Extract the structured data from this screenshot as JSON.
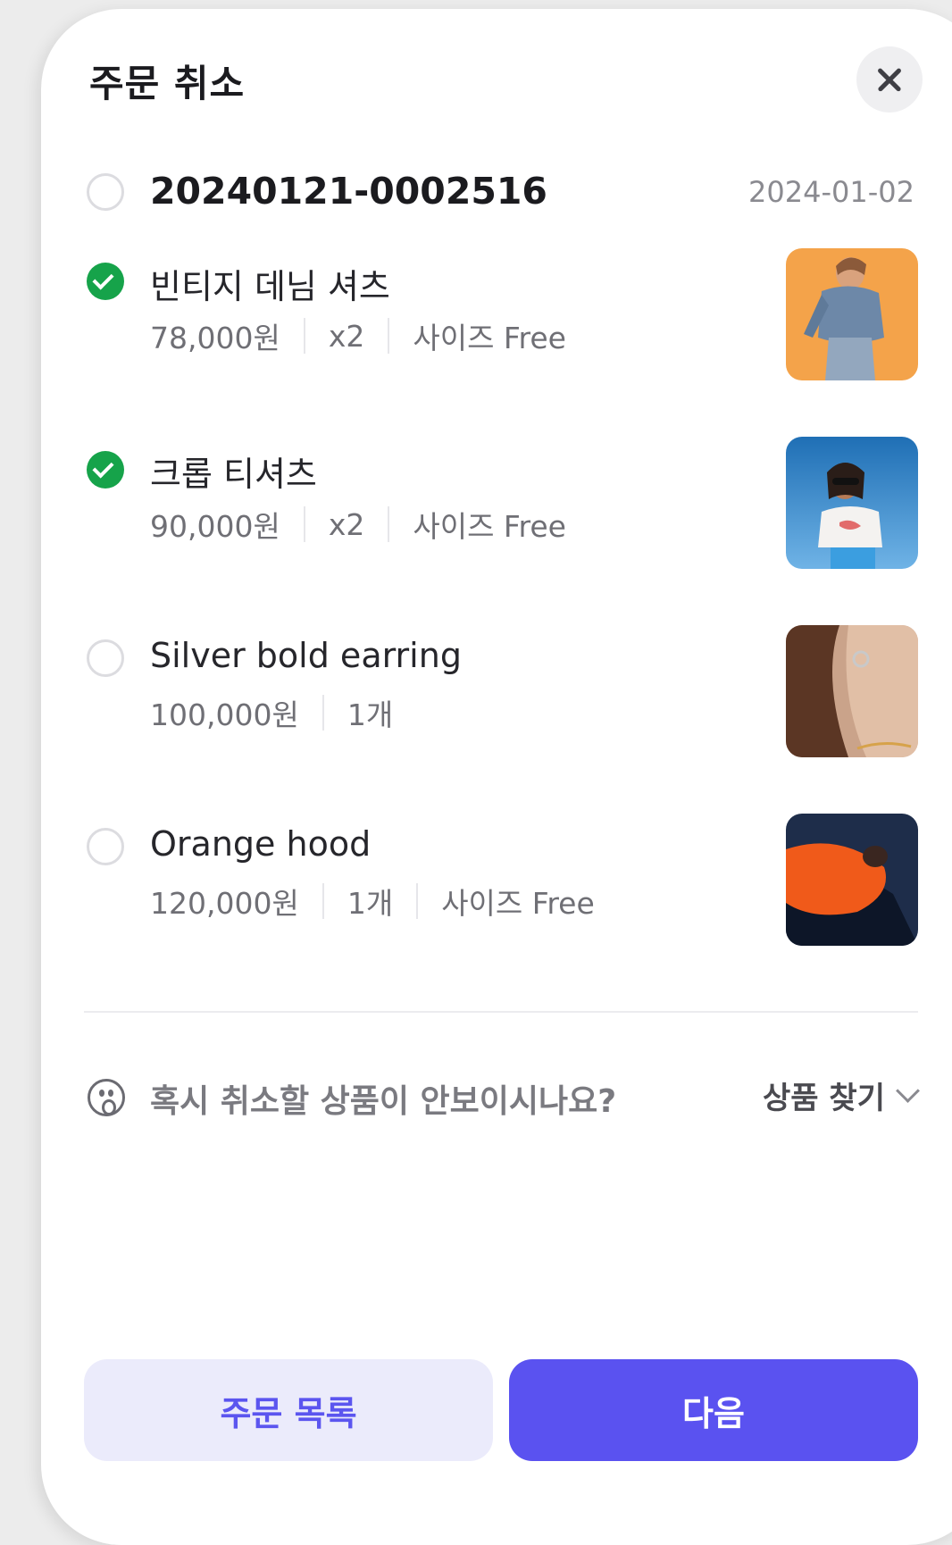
{
  "modal": {
    "title": "주문 취소"
  },
  "order": {
    "number": "20240121-0002516",
    "date": "2024-01-02",
    "checked": false
  },
  "items": [
    {
      "name": "빈티지 데님 셔츠",
      "price": "78,000원",
      "qty": "x2",
      "option": "사이즈 Free",
      "checked": true
    },
    {
      "name": "크롭 티셔츠",
      "price": "90,000원",
      "qty": "x2",
      "option": "사이즈 Free",
      "checked": true
    },
    {
      "name": "Silver bold earring",
      "price": "100,000원",
      "qty": "1개",
      "checked": false
    },
    {
      "name": "Orange hood",
      "price": "120,000원",
      "qty": "1개",
      "option": "사이즈 Free",
      "checked": false
    }
  ],
  "help": {
    "text": "혹시 취소할 상품이 안보이시나요?",
    "link": "상품 찾기",
    "icon": "surprised-face-icon"
  },
  "buttons": {
    "secondary": "주문 목록",
    "primary": "다음"
  },
  "colors": {
    "accent": "#5a52f0",
    "accent_light": "#ebebfb",
    "check_green": "#16a34a"
  }
}
